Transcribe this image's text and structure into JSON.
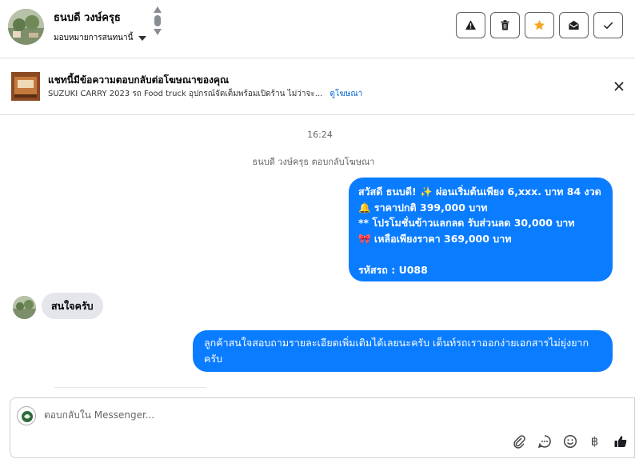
{
  "header": {
    "contact_name": "ธนบดี วงษ์ครุธ",
    "assign_label": "มอบหมายการสนทนานี้",
    "actions": [
      {
        "name": "report-button",
        "icon": "warning-icon"
      },
      {
        "name": "delete-button",
        "icon": "trash-icon"
      },
      {
        "name": "star-button",
        "icon": "star-icon"
      },
      {
        "name": "mark-unread-button",
        "icon": "envelope-open-icon"
      },
      {
        "name": "done-button",
        "icon": "check-icon"
      }
    ],
    "star_color": "#f5a623"
  },
  "ad": {
    "title": "แชทนี้มีข้อความตอบกลับต่อโฆษณาของคุณ",
    "description": "SUZUKI CARRY 2023 รถ Food truck อุปกรณ์จัดเต็มพร้อมเปิดร้าน ไม่ว่าจะ...",
    "link_label": "ดูโฆษณา"
  },
  "conversation": {
    "timestamp": "16:24",
    "reply_note": "ธนบดี วงษ์ครุธ ตอบกลับโฆษณา",
    "outgoing_1": {
      "lines": [
        "สวัสดี ธนบดี! ✨ ผ่อนเริ่มต้นเพียง 6,xxx. บาท 84 งวด",
        "🔔  ราคาปกติ 399,000 บาท",
        "** โปรโมชั่นข้าวแลกลด รับส่วนลด 30,000 บาท",
        "🎀 เหลือเพียงราคา 369,000 บาท",
        "",
        "รหัสรถ : U088"
      ]
    },
    "incoming_1": "สนใจครับ",
    "outgoing_2": "ลูกค้าสนใจสอบถามรายละเอียดเพิ่มเติมได้เลยนะครับ เต็นท์รถเราออกง่ายเอกสารไม่ยุ่งยากครับ"
  },
  "composer": {
    "placeholder": "ตอบกลับใน Messenger...",
    "tools": [
      "attach-icon",
      "saved-replies-icon",
      "emoji-icon",
      "payment-icon",
      "thumbs-up-icon"
    ],
    "payment_symbol": "฿"
  },
  "colors": {
    "outgoing_bubble": "#0a7cff",
    "incoming_bubble": "#e4e6eb",
    "link": "#0064d1"
  }
}
